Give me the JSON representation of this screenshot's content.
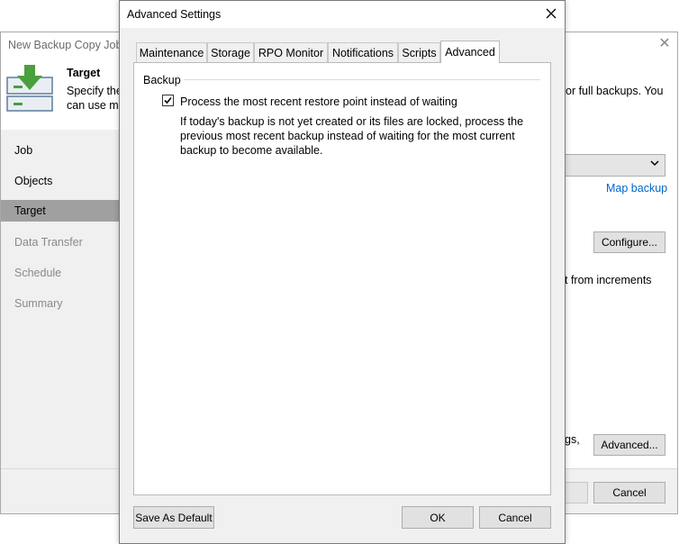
{
  "wizard": {
    "title": "New Backup Copy Job",
    "header_title": "Target",
    "header_desc_line1": "Specify the",
    "header_desc_line2": "can use ma",
    "header_right_text": "or full backups. You",
    "steps": [
      {
        "label": "Job",
        "state": "done"
      },
      {
        "label": "Objects",
        "state": "done"
      },
      {
        "label": "Target",
        "state": "active"
      },
      {
        "label": "Data Transfer",
        "state": "dim"
      },
      {
        "label": "Schedule",
        "state": "dim"
      },
      {
        "label": "Summary",
        "state": "dim"
      }
    ],
    "map_backup_link": "Map backup",
    "configure_button": "Configure...",
    "increments_text": "t from increments",
    "settings_text": "gs,",
    "advanced_button": "Advanced...",
    "cancel_button": "Cancel",
    "link_color": "#0066cc"
  },
  "dialog": {
    "title": "Advanced Settings",
    "tabs": [
      "Maintenance",
      "Storage",
      "RPO Monitor",
      "Notifications",
      "Scripts",
      "Advanced"
    ],
    "selected_tab": "Advanced",
    "group_label": "Backup",
    "checkbox_label": "Process the most recent restore point instead of waiting",
    "checkbox_checked": true,
    "description_line1": "If today's backup is not yet created or its files are locked, process the",
    "description_line2": "previous most recent backup instead of waiting for the most current",
    "description_line3": "backup to become available.",
    "save_default_button": "Save As Default",
    "ok_button": "OK",
    "cancel_button": "Cancel"
  }
}
